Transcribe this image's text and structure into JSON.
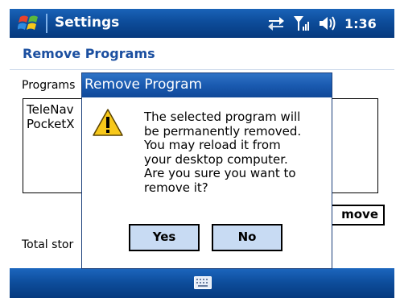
{
  "title_bar": {
    "app_title": "Settings",
    "clock": "1:36"
  },
  "header": {
    "title": "Remove Programs"
  },
  "content": {
    "programs_label": "Programs",
    "program_items": [
      "TeleNav",
      "PocketX"
    ],
    "remove_button_label": "move",
    "total_storage_label": "Total stor"
  },
  "dialog": {
    "title": "Remove Program",
    "message_lines": [
      "The selected program will",
      "be permanently removed.",
      "You may reload it from",
      "your desktop computer.",
      "Are you sure you want to",
      "remove it?"
    ],
    "yes_label": "Yes",
    "no_label": "No"
  },
  "colors": {
    "title_bar": "#0d4c9a",
    "header_text": "#1b4fa0",
    "dialog_title": "#1a5ab0",
    "dialog_button": "#c8dbf3",
    "warning": "#f7c81a"
  },
  "icons": {
    "start": "windows-flag-icon",
    "connectivity": "connectivity-arrows-icon",
    "signal": "signal-strength-icon",
    "volume": "speaker-icon",
    "warning": "warning-triangle-icon",
    "keyboard": "keyboard-icon"
  }
}
